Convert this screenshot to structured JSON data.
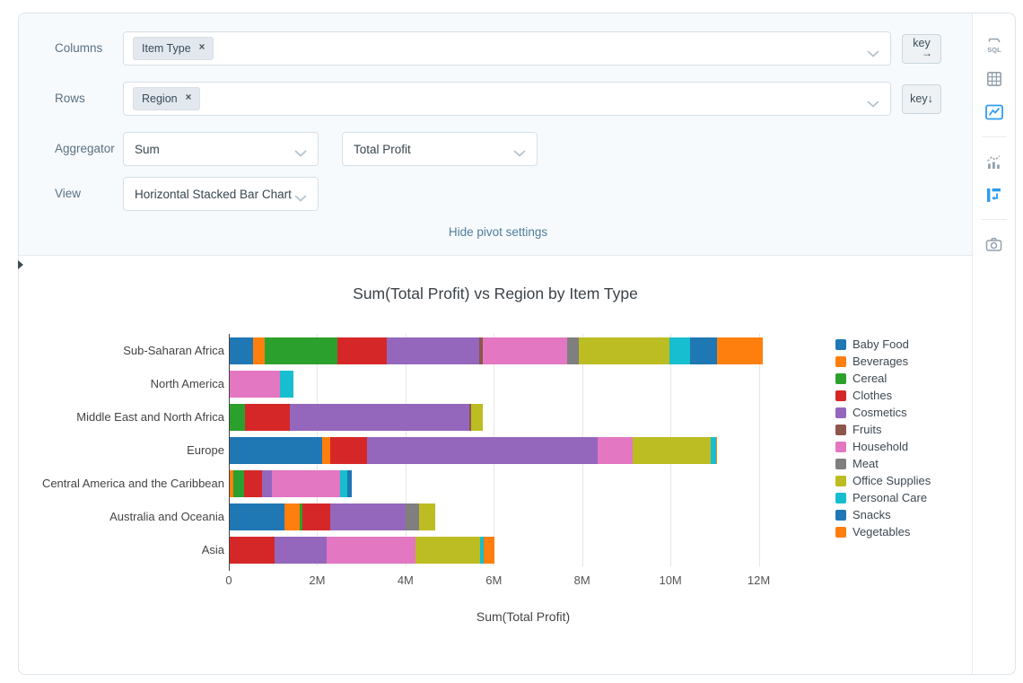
{
  "pivot_settings": {
    "columns_label": "Columns",
    "columns_tags": [
      "Item Type"
    ],
    "rows_label": "Rows",
    "rows_tags": [
      "Region"
    ],
    "aggregator_label": "Aggregator",
    "aggregator_value": "Sum",
    "aggregator_field_value": "Total Profit",
    "view_label": "View",
    "view_value": "Horizontal Stacked Bar Chart",
    "key_columns_button": "key",
    "key_columns_arrow": "→",
    "key_rows_button": "key↓",
    "tag_close": "×",
    "hide_link": "Hide pivot settings"
  },
  "toolbar": {
    "sql_text": "SQL",
    "icons": [
      "sql-icon",
      "table-icon",
      "chart-image-icon",
      "combo-chart-icon",
      "pivot-icon",
      "camera-icon"
    ],
    "active_icon": "chart-image-icon",
    "accent_color": "#2d9cf0",
    "inactive_color": "#93a1ad"
  },
  "chart_data": {
    "type": "bar",
    "orientation": "horizontal",
    "stacked": true,
    "title": "Sum(Total Profit) vs Region by Item Type",
    "xlabel": "Sum(Total Profit)",
    "ylabel": "",
    "unit": "millions",
    "xlim_m": [
      0,
      13.33
    ],
    "grid": "vertical",
    "legend_position": "right",
    "categories": [
      "Sub-Saharan Africa",
      "North America",
      "Middle East and North Africa",
      "Europe",
      "Central America and the Caribbean",
      "Australia and Oceania",
      "Asia"
    ],
    "ticks": [
      {
        "v": 0,
        "label": "0"
      },
      {
        "v": 2,
        "label": "2M"
      },
      {
        "v": 4,
        "label": "4M"
      },
      {
        "v": 6,
        "label": "6M"
      },
      {
        "v": 8,
        "label": "8M"
      },
      {
        "v": 10,
        "label": "10M"
      },
      {
        "v": 12,
        "label": "12M"
      }
    ],
    "series": [
      {
        "name": "Baby Food",
        "color": "#1f77b4",
        "values_m": [
          0.52,
          0,
          0,
          2.1,
          0,
          1.25,
          0
        ]
      },
      {
        "name": "Beverages",
        "color": "#ff7f0e",
        "values_m": [
          0.27,
          0,
          0,
          0.17,
          0.08,
          0.33,
          0
        ]
      },
      {
        "name": "Cereal",
        "color": "#2ca02c",
        "values_m": [
          1.65,
          0,
          0.34,
          0,
          0.25,
          0.07,
          0
        ]
      },
      {
        "name": "Clothes",
        "color": "#d62728",
        "values_m": [
          1.13,
          0,
          1.02,
          0.85,
          0.4,
          0.63,
          1.02
        ]
      },
      {
        "name": "Cosmetics",
        "color": "#9467bd",
        "values_m": [
          2.08,
          0,
          4.08,
          5.23,
          0.23,
          1.7,
          1.17
        ]
      },
      {
        "name": "Fruits",
        "color": "#8c564b",
        "values_m": [
          0.08,
          0,
          0.04,
          0,
          0,
          0,
          0
        ]
      },
      {
        "name": "Household",
        "color": "#e377c2",
        "values_m": [
          1.93,
          1.14,
          0,
          0.79,
          1.55,
          0,
          2.02
        ]
      },
      {
        "name": "Meat",
        "color": "#7f7f7f",
        "values_m": [
          0.25,
          0,
          0,
          0,
          0,
          0.32,
          0
        ]
      },
      {
        "name": "Office Supplies",
        "color": "#bcbd22",
        "values_m": [
          2.07,
          0,
          0.25,
          1.77,
          0,
          0.37,
          1.47
        ]
      },
      {
        "name": "Personal Care",
        "color": "#17becf",
        "values_m": [
          0.47,
          0.3,
          0,
          0.13,
          0.16,
          0,
          0.09
        ]
      },
      {
        "name": "Snacks",
        "color": "#1f77b4",
        "values_m": [
          0.6,
          0,
          0,
          0,
          0.1,
          0,
          0
        ]
      },
      {
        "name": "Vegetables",
        "color": "#ff7f0e",
        "values_m": [
          1.05,
          0,
          0,
          0.02,
          0,
          0,
          0.23
        ]
      }
    ]
  }
}
